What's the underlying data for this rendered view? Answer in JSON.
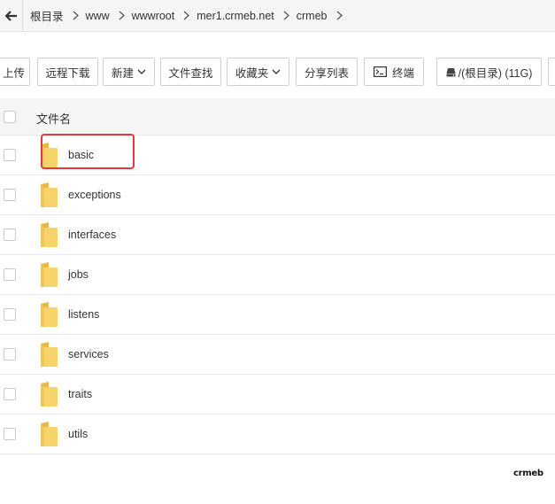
{
  "breadcrumb": {
    "items": [
      "根目录",
      "www",
      "wwwroot",
      "mer1.crmeb.net",
      "crmeb"
    ]
  },
  "toolbar": {
    "upload_label": "上传",
    "remote_download_label": "远程下载",
    "new_label": "新建",
    "file_search_label": "文件查找",
    "favorites_label": "收藏夹",
    "share_list_label": "分享列表",
    "terminal_label": "终端",
    "disk_label": "/(根目录) (11G)"
  },
  "table": {
    "name_header": "文件名",
    "rows": [
      {
        "name": "basic"
      },
      {
        "name": "exceptions"
      },
      {
        "name": "interfaces"
      },
      {
        "name": "jobs"
      },
      {
        "name": "listens"
      },
      {
        "name": "services"
      },
      {
        "name": "traits"
      },
      {
        "name": "utils"
      }
    ]
  },
  "logo": {
    "text": "crmeb"
  },
  "colors": {
    "highlight": "#e0393e",
    "folder_yellow": "#f6d46b",
    "folder_dark": "#e8b94a"
  },
  "icons": {
    "back": "arrow-left-icon",
    "separator": "chevron-right-icon",
    "dropdown": "chevron-down-icon",
    "terminal": "terminal-icon",
    "disk": "disk-icon",
    "folder": "folder-icon"
  }
}
